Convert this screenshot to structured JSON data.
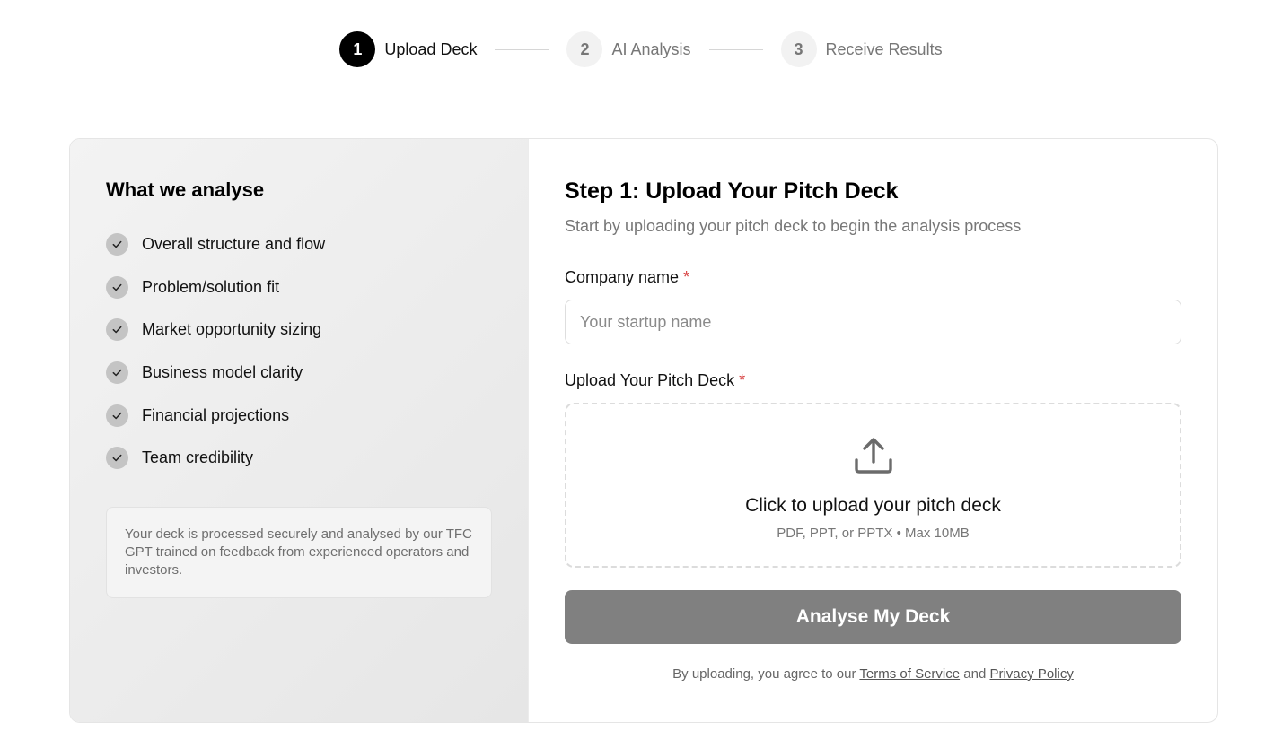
{
  "stepper": {
    "steps": [
      {
        "number": "1",
        "label": "Upload Deck"
      },
      {
        "number": "2",
        "label": "AI Analysis"
      },
      {
        "number": "3",
        "label": "Receive Results"
      }
    ]
  },
  "left": {
    "title": "What we analyse",
    "items": [
      "Overall structure and flow",
      "Problem/solution fit",
      "Market opportunity sizing",
      "Business model clarity",
      "Financial projections",
      "Team credibility"
    ],
    "note": "Your deck is processed securely and analysed by our TFC GPT trained on feedback from experienced operators and investors."
  },
  "right": {
    "title": "Step 1: Upload Your Pitch Deck",
    "subtitle": "Start by uploading your pitch deck to begin the analysis process",
    "company_label": "Company name",
    "required_mark": "*",
    "company_placeholder": "Your startup name",
    "company_value": "",
    "upload_label": "Upload Your Pitch Deck",
    "dropzone_title": "Click to upload your pitch deck",
    "dropzone_sub": "PDF, PPT, or PPTX • Max 10MB",
    "submit_label": "Analyse My Deck",
    "legal_prefix": "By uploading, you agree to our ",
    "terms_link": "Terms of Service",
    "legal_and": " and ",
    "privacy_link": "Privacy Policy"
  },
  "colors": {
    "active_step": "#000000",
    "inactive_step": "#f2f2f2",
    "required": "#d63a3a",
    "button": "#808080"
  },
  "icons": {
    "check": "check-icon",
    "upload": "upload-icon"
  }
}
